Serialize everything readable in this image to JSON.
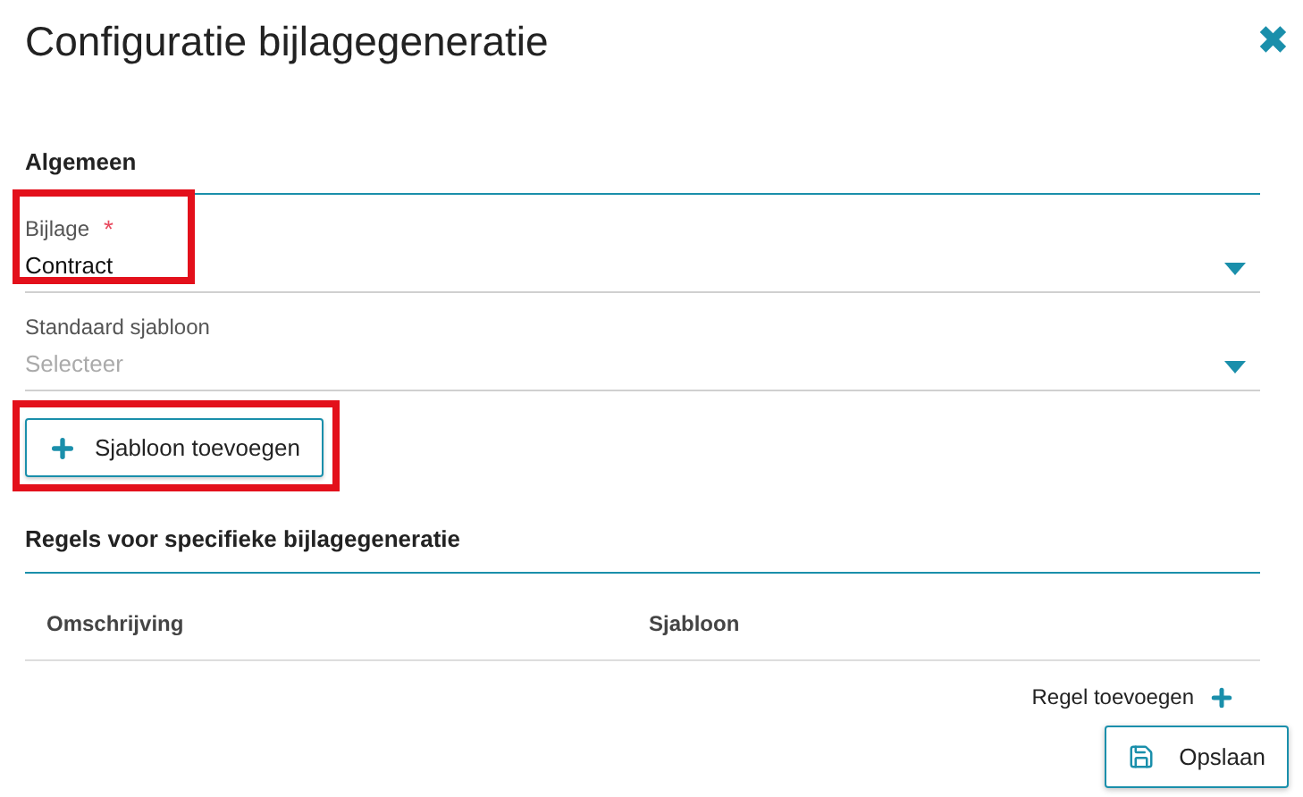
{
  "dialog": {
    "title": "Configuratie bijlagegeneratie",
    "close_icon": "✖"
  },
  "general": {
    "heading": "Algemeen",
    "fields": [
      {
        "label": "Bijlage",
        "required_mark": "*",
        "value": "Contract",
        "highlighted": true
      },
      {
        "label": "Standaard sjabloon",
        "placeholder": "Selecteer"
      }
    ],
    "add_template_button": {
      "label": "Sjabloon toevoegen",
      "highlighted": true
    }
  },
  "rules": {
    "heading": "Regels voor specifieke bijlagegeneratie",
    "table": {
      "columns": [
        "Omschrijving",
        "Sjabloon"
      ]
    },
    "add_rule_link": "Regel toevoegen"
  },
  "save_button": "Opslaan"
}
